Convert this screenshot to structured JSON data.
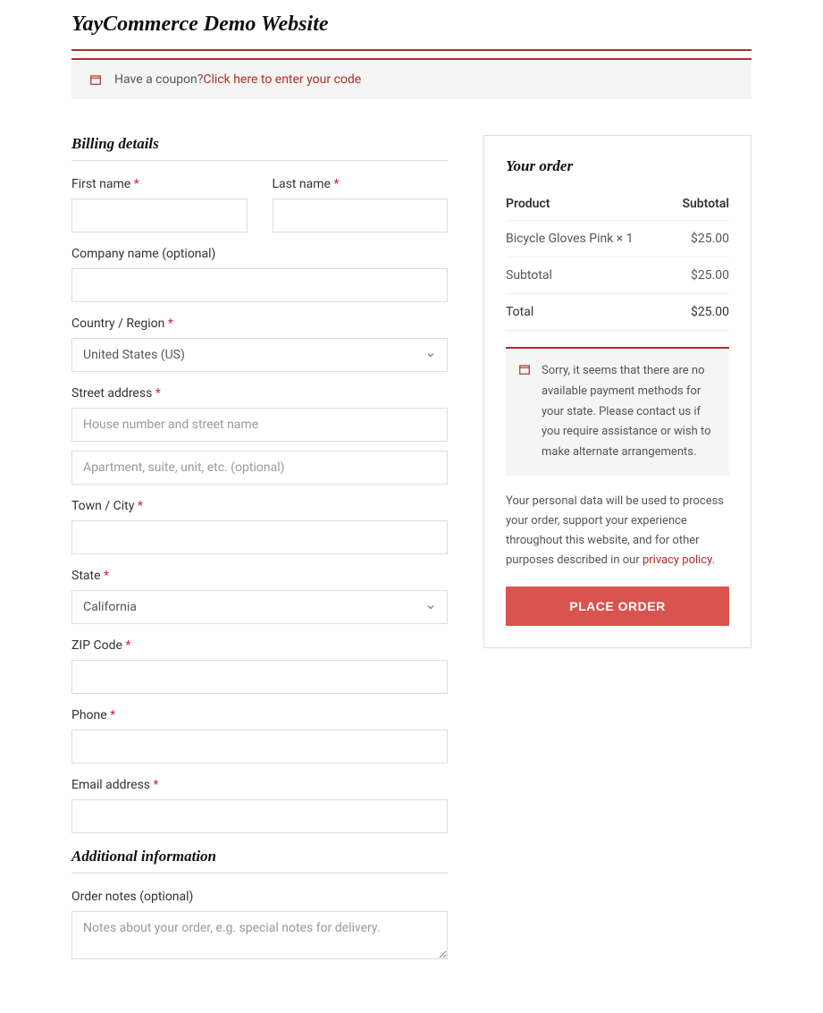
{
  "site_title": "YayCommerce Demo Website",
  "coupon": {
    "prompt": "Have a coupon? ",
    "link": "Click here to enter your code"
  },
  "billing": {
    "heading": "Billing details",
    "first_name_label": "First name",
    "last_name_label": "Last name",
    "company_label": "Company name (optional)",
    "country_label": "Country / Region",
    "country_value": "United States (US)",
    "street_label": "Street address",
    "street1_placeholder": "House number and street name",
    "street2_placeholder": "Apartment, suite, unit, etc. (optional)",
    "city_label": "Town / City",
    "state_label": "State",
    "state_value": "California",
    "zip_label": "ZIP Code",
    "phone_label": "Phone",
    "email_label": "Email address"
  },
  "additional": {
    "heading": "Additional information",
    "notes_label": "Order notes (optional)",
    "notes_placeholder": "Notes about your order, e.g. special notes for delivery."
  },
  "order": {
    "heading": "Your order",
    "product_header": "Product",
    "subtotal_header": "Subtotal",
    "line_item_name": "Bicycle Gloves Pink × 1",
    "line_item_price": "$25.00",
    "subtotal_label": "Subtotal",
    "subtotal_value": "$25.00",
    "total_label": "Total",
    "total_value": "$25.00",
    "notice": "Sorry, it seems that there are no available payment methods for your state. Please contact us if you require assistance or wish to make alternate arrangements.",
    "privacy_text": "Your personal data will be used to process your order, support your experience throughout this website, and for other purposes described in our ",
    "privacy_link": "privacy policy",
    "privacy_suffix": ".",
    "place_order": "PLACE ORDER"
  }
}
